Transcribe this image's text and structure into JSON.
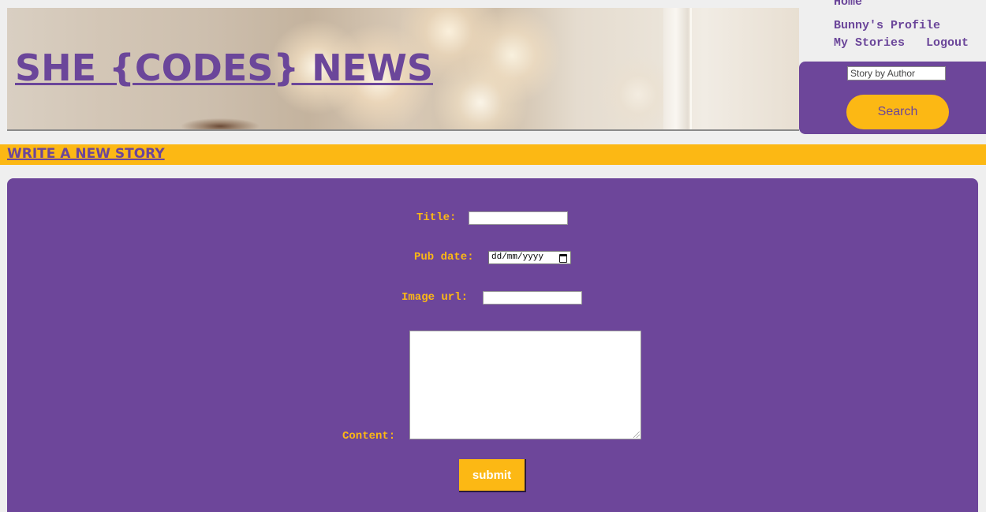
{
  "header": {
    "site_title": "SHE {CODES} NEWS"
  },
  "nav": {
    "home": "Home",
    "profile": "Bunny's Profile",
    "my_stories": "My Stories",
    "logout": "Logout"
  },
  "search": {
    "placeholder": "Story by Author",
    "button_label": "Search"
  },
  "section": {
    "link_label": "WRITE A NEW STORY"
  },
  "form": {
    "title_label": "Title:",
    "title_value": "",
    "pub_date_label": "Pub date:",
    "pub_date_placeholder": "dd/mm/yyyy",
    "image_url_label": "Image url:",
    "image_url_value": "",
    "content_label": "Content:",
    "submit_label": "submit"
  },
  "colors": {
    "brand_purple": "#6d469a",
    "accent_yellow": "#fcb814",
    "page_background": "#efefef"
  }
}
